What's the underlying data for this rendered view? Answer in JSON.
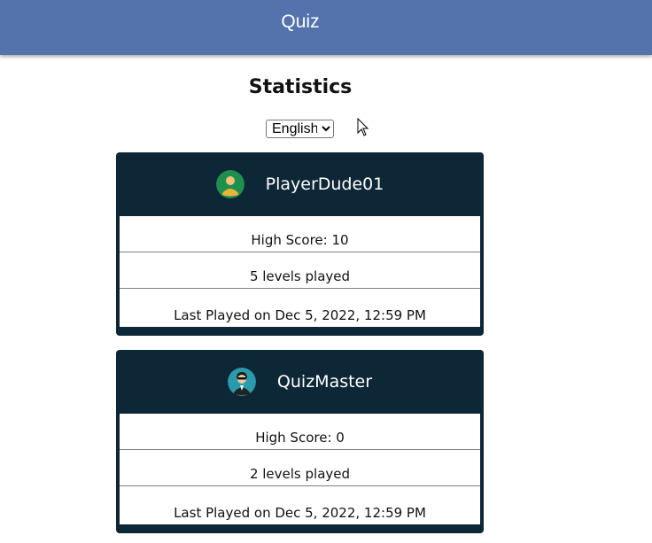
{
  "header": {
    "title": "Quiz"
  },
  "page": {
    "title": "Statistics"
  },
  "language": {
    "selected": "English",
    "options": [
      "English"
    ]
  },
  "players": [
    {
      "name": "PlayerDude01",
      "avatar_icon": "user-avatar-green-icon",
      "high_score": "High Score: 10",
      "levels": "5 levels played",
      "last_played": "Last Played on Dec 5, 2022, 12:59 PM"
    },
    {
      "name": "QuizMaster",
      "avatar_icon": "user-avatar-suit-icon",
      "high_score": "High Score: 0",
      "levels": "2 levels played",
      "last_played": "Last Played on Dec 5, 2022, 12:59 PM"
    }
  ],
  "colors": {
    "app_bar": "#5472ab",
    "card_header": "#0e2736"
  }
}
